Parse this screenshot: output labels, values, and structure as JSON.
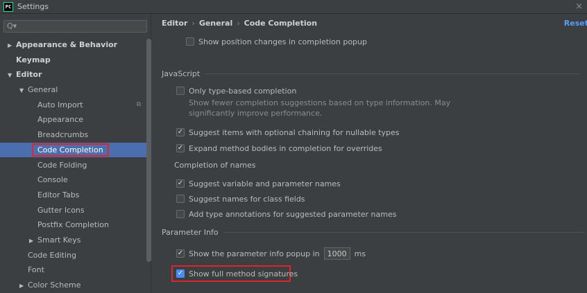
{
  "window": {
    "logo": "PC",
    "title": "Settings",
    "close_glyph": "×"
  },
  "sidebar": {
    "search": {
      "icon": "Q▾",
      "placeholder": ""
    },
    "items": [
      {
        "label": "Appearance & Behavior",
        "arrow": "▶"
      },
      {
        "label": "Keymap",
        "arrow": ""
      },
      {
        "label": "Editor",
        "arrow": "▼"
      },
      {
        "label": "General",
        "arrow": "▼"
      },
      {
        "label": "Auto Import",
        "arrow": ""
      },
      {
        "label": "Appearance",
        "arrow": ""
      },
      {
        "label": "Breadcrumbs",
        "arrow": ""
      },
      {
        "label": "Code Completion",
        "arrow": ""
      },
      {
        "label": "Code Folding",
        "arrow": ""
      },
      {
        "label": "Console",
        "arrow": ""
      },
      {
        "label": "Editor Tabs",
        "arrow": ""
      },
      {
        "label": "Gutter Icons",
        "arrow": ""
      },
      {
        "label": "Postfix Completion",
        "arrow": ""
      },
      {
        "label": "Smart Keys",
        "arrow": "▶"
      },
      {
        "label": "Code Editing",
        "arrow": ""
      },
      {
        "label": "Font",
        "arrow": ""
      },
      {
        "label": "Color Scheme",
        "arrow": "▶"
      }
    ],
    "copy_icon": "⧉"
  },
  "main": {
    "breadcrumb": [
      "Editor",
      "General",
      "Code Completion"
    ],
    "breadcrumb_sep": "›",
    "reset": "Reset",
    "show_position_changes": "Show position changes in completion popup",
    "javascript": {
      "title": "JavaScript",
      "only_type_based": "Only type-based completion",
      "only_type_based_desc_1": "Show fewer completion suggestions based on type information. May",
      "only_type_based_desc_2": "significantly improve performance.",
      "optional_chaining": "Suggest items with optional chaining for nullable types",
      "expand_method_bodies": "Expand method bodies in completion for overrides",
      "completion_of_names": "Completion of names",
      "suggest_variable": "Suggest variable and parameter names",
      "suggest_class_fields": "Suggest names for class fields",
      "add_type_annotations": "Add type annotations for suggested parameter names"
    },
    "parameter_info": {
      "title": "Parameter Info",
      "show_popup_prefix": "Show the parameter info popup in",
      "popup_delay": "1000",
      "popup_unit": "ms",
      "show_full_signatures": "Show full method signatures"
    }
  },
  "colors": {
    "background": "#3c3f41",
    "selection": "#4b6eaf",
    "link": "#589df6",
    "highlight_annotation": "#e0242b",
    "checkbox_blue": "#4b8bf5"
  }
}
